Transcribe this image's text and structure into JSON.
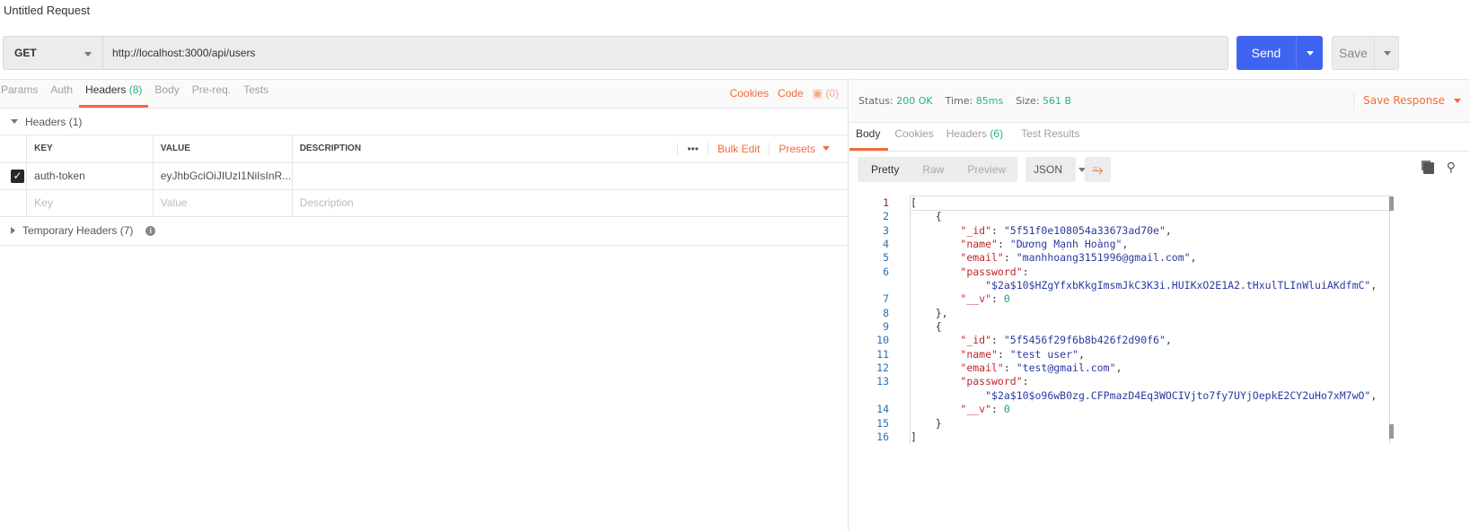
{
  "window": {
    "title": "Untitled Request"
  },
  "request": {
    "method": "GET",
    "url": "http://localhost:3000/api/users",
    "send_label": "Send",
    "save_label": "Save"
  },
  "req_tabs": [
    {
      "label": "Params"
    },
    {
      "label": "Auth"
    },
    {
      "label": "Headers",
      "count": "(8)"
    },
    {
      "label": "Body"
    },
    {
      "label": "Pre-req."
    },
    {
      "label": "Tests"
    }
  ],
  "req_links": {
    "cookies": "Cookies",
    "code": "Code",
    "comments": "(0)"
  },
  "headers_section": {
    "title": "Headers (1)",
    "columns": [
      "KEY",
      "VALUE",
      "DESCRIPTION"
    ],
    "more": "•••",
    "bulk_edit": "Bulk Edit",
    "presets": "Presets",
    "rows": [
      {
        "key": "auth-token",
        "value": "eyJhbGciOiJIUzI1NiIsInR...",
        "description": ""
      }
    ],
    "placeholders": {
      "key": "Key",
      "value": "Value",
      "description": "Description"
    }
  },
  "temp_headers": {
    "title": "Temporary Headers (7)"
  },
  "response": {
    "status_label": "Status:",
    "status": "200 OK",
    "time_label": "Time:",
    "time": "85ms",
    "size_label": "Size:",
    "size": "561 B",
    "save_response": "Save Response",
    "tabs": [
      {
        "label": "Body"
      },
      {
        "label": "Cookies"
      },
      {
        "label": "Headers",
        "count": "(6)"
      },
      {
        "label": "Test Results"
      }
    ],
    "views": [
      "Pretty",
      "Raw",
      "Preview"
    ],
    "format": "JSON",
    "lines": [
      {
        "n": "1",
        "t": [
          [
            "p",
            "["
          ]
        ]
      },
      {
        "n": "2",
        "t": [
          [
            "p",
            "    {"
          ]
        ]
      },
      {
        "n": "3",
        "t": [
          [
            "p",
            "        "
          ],
          [
            "k",
            "\"_id\""
          ],
          [
            "p",
            ": "
          ],
          [
            "s",
            "\"5f51f0e108054a33673ad70e\""
          ],
          [
            "p",
            ","
          ]
        ]
      },
      {
        "n": "4",
        "t": [
          [
            "p",
            "        "
          ],
          [
            "k",
            "\"name\""
          ],
          [
            "p",
            ": "
          ],
          [
            "s",
            "\"Dương Mạnh Hoàng\""
          ],
          [
            "p",
            ","
          ]
        ]
      },
      {
        "n": "5",
        "t": [
          [
            "p",
            "        "
          ],
          [
            "k",
            "\"email\""
          ],
          [
            "p",
            ": "
          ],
          [
            "s",
            "\"manhhoang3151996@gmail.com\""
          ],
          [
            "p",
            ","
          ]
        ]
      },
      {
        "n": "6",
        "t": [
          [
            "p",
            "        "
          ],
          [
            "k",
            "\"password\""
          ],
          [
            "p",
            ":"
          ]
        ]
      },
      {
        "n": "",
        "t": [
          [
            "p",
            "            "
          ],
          [
            "s",
            "\"$2a$10$HZgYfxbKkgImsmJkC3K3i.HUIKxO2E1A2.tHxulTLInWluiAKdfmC\""
          ],
          [
            "p",
            ","
          ]
        ]
      },
      {
        "n": "7",
        "t": [
          [
            "p",
            "        "
          ],
          [
            "k",
            "\"__v\""
          ],
          [
            "p",
            ": "
          ],
          [
            "n",
            "0"
          ]
        ]
      },
      {
        "n": "8",
        "t": [
          [
            "p",
            "    },"
          ]
        ]
      },
      {
        "n": "9",
        "t": [
          [
            "p",
            "    {"
          ]
        ]
      },
      {
        "n": "10",
        "t": [
          [
            "p",
            "        "
          ],
          [
            "k",
            "\"_id\""
          ],
          [
            "p",
            ": "
          ],
          [
            "s",
            "\"5f5456f29f6b8b426f2d90f6\""
          ],
          [
            "p",
            ","
          ]
        ]
      },
      {
        "n": "11",
        "t": [
          [
            "p",
            "        "
          ],
          [
            "k",
            "\"name\""
          ],
          [
            "p",
            ": "
          ],
          [
            "s",
            "\"test user\""
          ],
          [
            "p",
            ","
          ]
        ]
      },
      {
        "n": "12",
        "t": [
          [
            "p",
            "        "
          ],
          [
            "k",
            "\"email\""
          ],
          [
            "p",
            ": "
          ],
          [
            "s",
            "\"test@gmail.com\""
          ],
          [
            "p",
            ","
          ]
        ]
      },
      {
        "n": "13",
        "t": [
          [
            "p",
            "        "
          ],
          [
            "k",
            "\"password\""
          ],
          [
            "p",
            ":"
          ]
        ]
      },
      {
        "n": "",
        "t": [
          [
            "p",
            "            "
          ],
          [
            "s",
            "\"$2a$10$o96wB0zg.CFPmazD4Eq3WOCIVjto7fy7UYjOepkE2CY2uHo7xM7wO\""
          ],
          [
            "p",
            ","
          ]
        ]
      },
      {
        "n": "14",
        "t": [
          [
            "p",
            "        "
          ],
          [
            "k",
            "\"__v\""
          ],
          [
            "p",
            ": "
          ],
          [
            "n",
            "0"
          ]
        ]
      },
      {
        "n": "15",
        "t": [
          [
            "p",
            "    }"
          ]
        ]
      },
      {
        "n": "16",
        "t": [
          [
            "p",
            "]"
          ]
        ]
      }
    ]
  },
  "colors": {
    "accent": "#f26b3a",
    "send": "#3f64f2",
    "success": "#26b47f"
  }
}
